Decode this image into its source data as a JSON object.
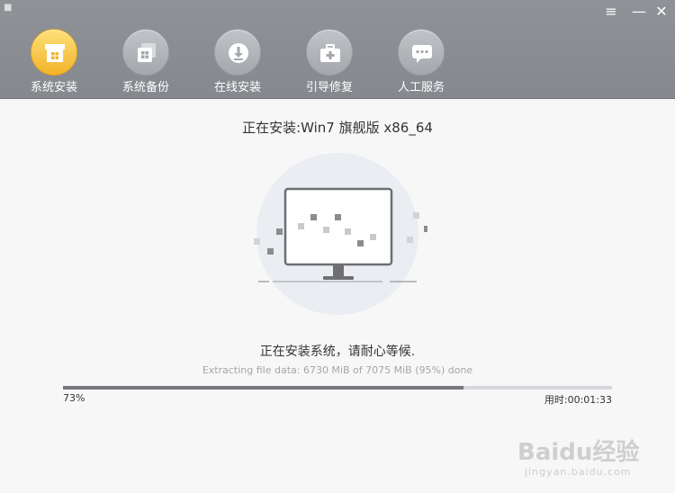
{
  "window": {
    "corner_mark": "■",
    "menu_icon": "hamburger-menu-icon",
    "minimize_icon": "minimize-icon",
    "close_icon": "close-icon"
  },
  "nav": {
    "items": [
      {
        "label": "系统安装",
        "icon": "box-windows-icon",
        "active": true
      },
      {
        "label": "系统备份",
        "icon": "backup-windows-icon",
        "active": false
      },
      {
        "label": "在线安装",
        "icon": "download-icon",
        "active": false
      },
      {
        "label": "引导修复",
        "icon": "toolbox-plus-icon",
        "active": false
      },
      {
        "label": "人工服务",
        "icon": "chat-bubble-icon",
        "active": false
      }
    ],
    "active_color": "#f5b82e"
  },
  "install": {
    "title": "正在安装:Win7 旗舰版 x86_64",
    "status": "正在安装系统，请耐心等候.",
    "detail": "Extracting file data: 6730 MiB of 7075 MiB (95%) done",
    "progress_value": 0.73,
    "progress_label": "73%",
    "elapsed": "用时:00:01:33"
  },
  "watermark": {
    "brand": "Baidu经验",
    "url": "jingyan.baidu.com"
  }
}
